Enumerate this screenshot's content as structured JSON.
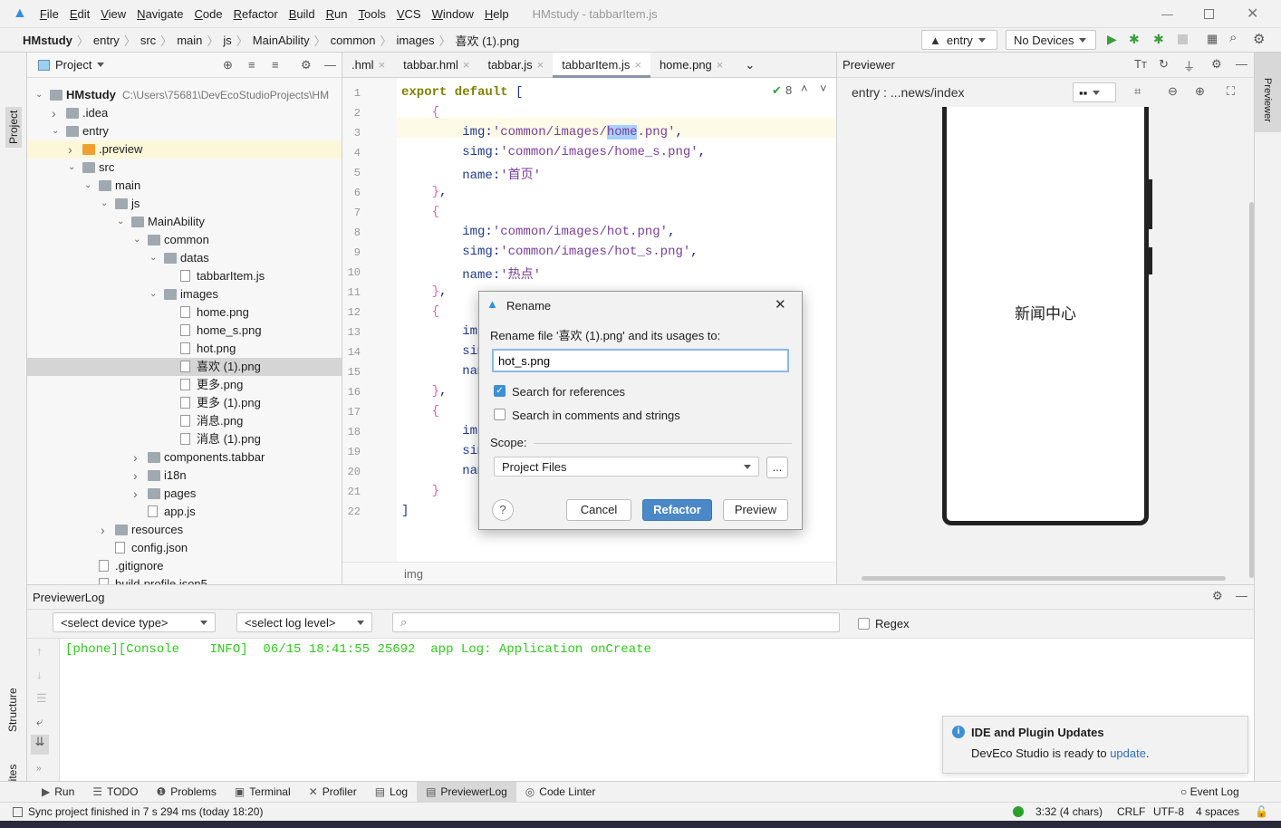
{
  "title": {
    "menus": [
      "File",
      "Edit",
      "View",
      "Navigate",
      "Code",
      "Refactor",
      "Build",
      "Run",
      "Tools",
      "VCS",
      "Window",
      "Help"
    ],
    "window_title": "HMstudy - tabbarItem.js"
  },
  "breadcrumb": [
    "HMstudy",
    "entry",
    "src",
    "main",
    "js",
    "MainAbility",
    "common",
    "images",
    "喜欢 (1).png"
  ],
  "run": {
    "config": "entry",
    "device": "No Devices"
  },
  "left_strip": {
    "project": "Project",
    "structure": "Structure",
    "favorites": "Favorites"
  },
  "project": {
    "header": "Project",
    "root_path": "C:\\Users\\75681\\DevEcoStudioProjects\\HM",
    "tree": [
      {
        "label": "HMstudy",
        "level": 0,
        "type": "folder",
        "open": true,
        "bold": true
      },
      {
        "label": ".idea",
        "level": 1,
        "type": "folder",
        "open": false
      },
      {
        "label": "entry",
        "level": 1,
        "type": "folder",
        "open": true
      },
      {
        "label": ".preview",
        "level": 2,
        "type": "folder",
        "open": false,
        "state": "highlight"
      },
      {
        "label": "src",
        "level": 2,
        "type": "folder",
        "open": true
      },
      {
        "label": "main",
        "level": 3,
        "type": "folder",
        "open": true
      },
      {
        "label": "js",
        "level": 4,
        "type": "folder",
        "open": true
      },
      {
        "label": "MainAbility",
        "level": 5,
        "type": "folder",
        "open": true
      },
      {
        "label": "common",
        "level": 6,
        "type": "folder",
        "open": true
      },
      {
        "label": "datas",
        "level": 7,
        "type": "folder",
        "open": true
      },
      {
        "label": "tabbarItem.js",
        "level": 8,
        "type": "file"
      },
      {
        "label": "images",
        "level": 7,
        "type": "folder",
        "open": true
      },
      {
        "label": "home.png",
        "level": 8,
        "type": "file"
      },
      {
        "label": "home_s.png",
        "level": 8,
        "type": "file"
      },
      {
        "label": "hot.png",
        "level": 8,
        "type": "file"
      },
      {
        "label": "喜欢 (1).png",
        "level": 8,
        "type": "file",
        "state": "selected"
      },
      {
        "label": "更多.png",
        "level": 8,
        "type": "file"
      },
      {
        "label": "更多 (1).png",
        "level": 8,
        "type": "file"
      },
      {
        "label": "消息.png",
        "level": 8,
        "type": "file"
      },
      {
        "label": "消息 (1).png",
        "level": 8,
        "type": "file"
      },
      {
        "label": "components.tabbar",
        "level": 6,
        "type": "folder",
        "open": false
      },
      {
        "label": "i18n",
        "level": 6,
        "type": "folder",
        "open": false
      },
      {
        "label": "pages",
        "level": 6,
        "type": "folder",
        "open": false
      },
      {
        "label": "app.js",
        "level": 6,
        "type": "file"
      },
      {
        "label": "resources",
        "level": 4,
        "type": "folder",
        "open": false
      },
      {
        "label": "config.json",
        "level": 4,
        "type": "file"
      },
      {
        "label": ".gitignore",
        "level": 3,
        "type": "file"
      },
      {
        "label": "build-profile.json5",
        "level": 3,
        "type": "file"
      }
    ]
  },
  "editor": {
    "tabs": [
      {
        "label": ".hml"
      },
      {
        "label": "tabbar.hml"
      },
      {
        "label": "tabbar.js"
      },
      {
        "label": "tabbarItem.js",
        "active": true
      },
      {
        "label": "home.png"
      }
    ],
    "inspection_count": "8",
    "footer": "img",
    "lines": [
      [
        [
          "kw",
          "export default "
        ],
        [
          "key",
          "["
        ]
      ],
      [
        [
          "br",
          "    {"
        ]
      ],
      [
        [
          "key",
          "        img"
        ],
        [
          "",
          ":"
        ],
        [
          "str",
          "'common/images/home.png'"
        ],
        [
          "",
          ","
        ]
      ],
      [
        [
          "key",
          "        simg"
        ],
        [
          "",
          ":"
        ],
        [
          "str",
          "'common/images/home_s.png'"
        ],
        [
          "",
          ","
        ]
      ],
      [
        [
          "key",
          "        name"
        ],
        [
          "",
          ":"
        ],
        [
          "str",
          "'首页'"
        ]
      ],
      [
        [
          "br",
          "    }"
        ],
        [
          "",
          ","
        ]
      ],
      [
        [
          "br",
          "    {"
        ]
      ],
      [
        [
          "key",
          "        img"
        ],
        [
          "",
          ":"
        ],
        [
          "str",
          "'common/images/hot.png'"
        ],
        [
          "",
          ","
        ]
      ],
      [
        [
          "key",
          "        simg"
        ],
        [
          "",
          ":"
        ],
        [
          "str",
          "'common/images/hot_s.png'"
        ],
        [
          "",
          ","
        ]
      ],
      [
        [
          "key",
          "        name"
        ],
        [
          "",
          ":"
        ],
        [
          "str",
          "'热点'"
        ]
      ],
      [
        [
          "br",
          "    }"
        ],
        [
          "",
          ","
        ]
      ],
      [
        [
          "br",
          "    {"
        ]
      ],
      [
        [
          "key",
          "        img"
        ]
      ],
      [
        [
          "key",
          "        sim"
        ]
      ],
      [
        [
          "key",
          "        nam"
        ]
      ],
      [
        [
          "br",
          "    }"
        ],
        [
          "",
          ","
        ]
      ],
      [
        [
          "br",
          "    {"
        ]
      ],
      [
        [
          "key",
          "        img"
        ]
      ],
      [
        [
          "key",
          "        sim"
        ]
      ],
      [
        [
          "key",
          "        nam"
        ]
      ],
      [
        [
          "br",
          "    }"
        ]
      ],
      [
        [
          "key",
          "]"
        ]
      ]
    ]
  },
  "previewer": {
    "title": "Previewer",
    "route": "entry : ...news/index",
    "screen_text": "新闻中心"
  },
  "right_strip": {
    "label": "Previewer"
  },
  "log": {
    "title": "PreviewerLog",
    "device_select": "<select device type>",
    "level_select": "<select log level>",
    "search_placeholder": "",
    "regex": "Regex",
    "line": "[phone][Console    INFO]  06/15 18:41:55 25692  app Log: Application onCreate",
    "color": "#2ecc1a"
  },
  "tool_windows": [
    "Run",
    "TODO",
    "Problems",
    "Terminal",
    "Profiler",
    "Log",
    "PreviewerLog",
    "Code Linter"
  ],
  "event_log": "Event Log",
  "status": {
    "message": "Sync project finished in 7 s 294 ms (today 18:20)",
    "position": "3:32 (4 chars)",
    "line_sep": "CRLF",
    "encoding": "UTF-8",
    "indent": "4 spaces"
  },
  "notification": {
    "title": "IDE and Plugin Updates",
    "text": "DevEco Studio is ready to ",
    "link": "update",
    "end": "."
  },
  "dialog": {
    "title": "Rename",
    "prompt": "Rename file '喜欢 (1).png' and its usages to:",
    "value": "hot_s.png",
    "search_refs": "Search for references",
    "search_refs_checked": true,
    "search_comments": "Search in comments and strings",
    "search_comments_checked": false,
    "scope_label": "Scope:",
    "scope": "Project Files",
    "more": "...",
    "cancel": "Cancel",
    "refactor": "Refactor",
    "preview": "Preview",
    "help": "?"
  },
  "colors": {
    "accent": "#3d8fd6",
    "selection": "#d5d5d5",
    "log_green": "#2ecc1a"
  }
}
